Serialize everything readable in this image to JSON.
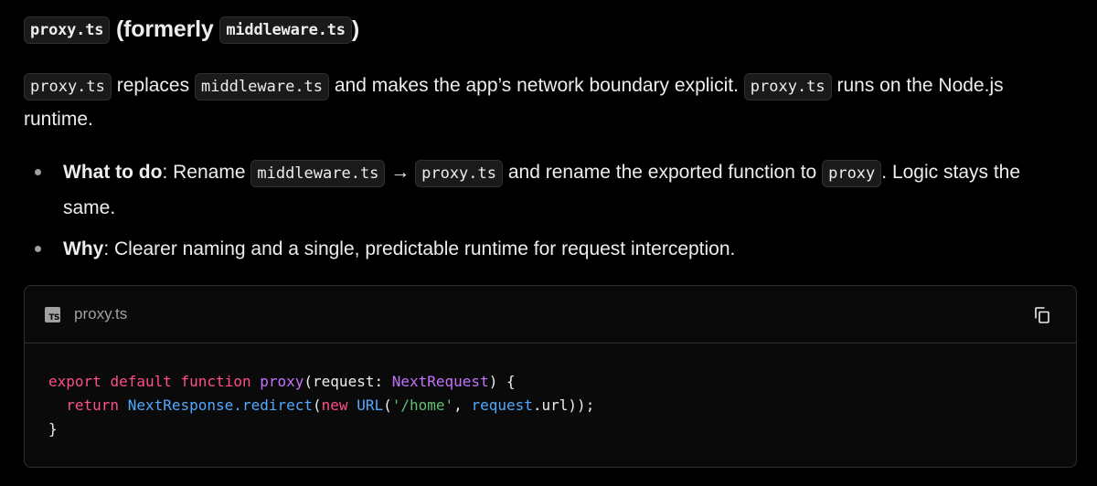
{
  "heading": {
    "code1": "proxy.ts",
    "text_open": "(formerly",
    "code2": "middleware.ts",
    "text_close": ")"
  },
  "intro": {
    "code1": "proxy.ts",
    "t1": "replaces",
    "code2": "middleware.ts",
    "t2": "and makes the app’s network boundary explicit.",
    "code3": "proxy.ts",
    "t3": "runs on the Node.js runtime."
  },
  "bullets": [
    {
      "label": "What to do",
      "t1": ": Rename",
      "code1": "middleware.ts",
      "arrow": "→",
      "code2": "proxy.ts",
      "t2": "and rename the exported function to",
      "code3": "proxy",
      "t3": ". Logic stays the same."
    },
    {
      "label": "Why",
      "t1": ": Clearer naming and a single, predictable runtime for request interception."
    }
  ],
  "codeblock": {
    "icon": "ts-file-icon",
    "icon_text": "TS",
    "filename": "proxy.ts",
    "copy_icon": "copy-icon",
    "lines": {
      "l1": {
        "export": "export",
        "default": "default",
        "function": "function",
        "name": "proxy",
        "open": "(",
        "param": "request",
        "colon": ": ",
        "type": "NextRequest",
        "close": ") {"
      },
      "l2": {
        "indent": "  ",
        "return": "return",
        "obj": "NextResponse",
        "dot": ".",
        "method": "redirect",
        "open": "(",
        "new": "new",
        "cls": "URL",
        "open2": "(",
        "str": "'/home'",
        "comma": ", ",
        "req": "request",
        "dot2": ".",
        "prop": "url",
        "close": "));"
      },
      "l3": {
        "brace": "}"
      }
    }
  },
  "colors": {
    "background": "#000000",
    "text": "#ededed",
    "keyword": "#ff4d8d",
    "function": "#c472fb",
    "builtin": "#52a8ff",
    "string": "#62c073",
    "border": "#2e2e2e"
  }
}
